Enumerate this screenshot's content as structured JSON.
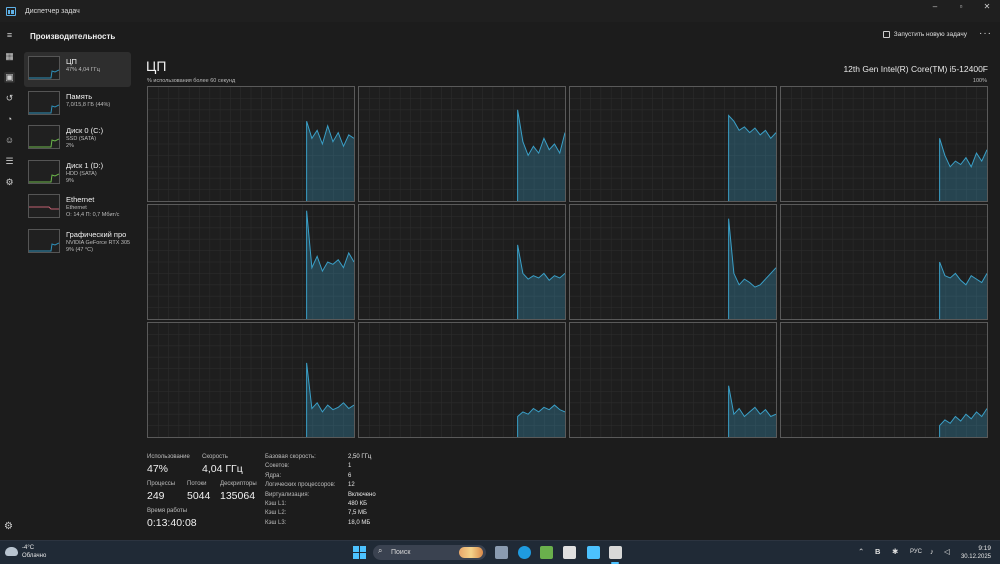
{
  "window": {
    "title": "Диспетчер задач",
    "controls": [
      "–",
      "▫",
      "✕"
    ]
  },
  "header": {
    "page_title": "Производительность",
    "run_task_label": "Запустить новую задачу",
    "more": "···"
  },
  "sidebar": {
    "items": [
      {
        "name": "ЦП",
        "sub1": "47% 4,04 ГГц",
        "sub2": "",
        "sub3": "",
        "selected": true,
        "trace": "#2e8fb8"
      },
      {
        "name": "Память",
        "sub1": "7,0/15,8 ГБ (44%)",
        "sub2": "",
        "sub3": "",
        "selected": false,
        "trace": "#2e8fb8"
      },
      {
        "name": "Диск 0 (C:)",
        "sub1": "SSD (SATA)",
        "sub2": "2%",
        "sub3": "",
        "selected": false,
        "trace": "#6bb64a"
      },
      {
        "name": "Диск 1 (D:)",
        "sub1": "HDD (SATA)",
        "sub2": "9%",
        "sub3": "",
        "selected": false,
        "trace": "#6bb64a"
      },
      {
        "name": "Ethernet",
        "sub1": "Ethernet",
        "sub2": "О: 14,4 П: 0,7 Мбит/с",
        "sub3": "",
        "selected": false,
        "trace": "#c06070"
      },
      {
        "name": "Графический про",
        "sub1": "NVIDIA GeForce RTX 305",
        "sub2": "9% (47 °C)",
        "sub3": "",
        "selected": false,
        "trace": "#2e8fb8"
      }
    ]
  },
  "cpu": {
    "title": "ЦП",
    "model": "12th Gen Intel(R) Core(TM) i5-12400F",
    "axis_label_left": "% использования более 60 секунд",
    "axis_label_right": "100%",
    "graph_color": "#3aa0c8",
    "core_series": [
      [
        0.7,
        0.55,
        0.62,
        0.5,
        0.66,
        0.52,
        0.6,
        0.48,
        0.58,
        0.55
      ],
      [
        0.8,
        0.52,
        0.4,
        0.48,
        0.42,
        0.55,
        0.45,
        0.5,
        0.42,
        0.6
      ],
      [
        0.75,
        0.7,
        0.62,
        0.65,
        0.6,
        0.64,
        0.58,
        0.62,
        0.55,
        0.6
      ],
      [
        0.55,
        0.4,
        0.3,
        0.35,
        0.32,
        0.38,
        0.3,
        0.42,
        0.35,
        0.45
      ],
      [
        0.95,
        0.45,
        0.55,
        0.42,
        0.5,
        0.48,
        0.52,
        0.45,
        0.58,
        0.5
      ],
      [
        0.65,
        0.4,
        0.35,
        0.38,
        0.36,
        0.4,
        0.34,
        0.38,
        0.36,
        0.4
      ],
      [
        0.88,
        0.4,
        0.3,
        0.35,
        0.32,
        0.28,
        0.3,
        0.35,
        0.4,
        0.45
      ],
      [
        0.5,
        0.38,
        0.36,
        0.4,
        0.34,
        0.3,
        0.38,
        0.35,
        0.32,
        0.4
      ],
      [
        0.65,
        0.25,
        0.3,
        0.22,
        0.28,
        0.24,
        0.26,
        0.3,
        0.25,
        0.28
      ],
      [
        0.18,
        0.22,
        0.2,
        0.25,
        0.22,
        0.26,
        0.24,
        0.28,
        0.24,
        0.22
      ],
      [
        0.45,
        0.2,
        0.25,
        0.18,
        0.22,
        0.26,
        0.2,
        0.24,
        0.18,
        0.2
      ],
      [
        0.1,
        0.15,
        0.12,
        0.18,
        0.14,
        0.2,
        0.16,
        0.22,
        0.18,
        0.25
      ]
    ],
    "stats": {
      "usage_label": "Использование",
      "usage_value": "47%",
      "speed_label": "Скорость",
      "speed_value": "4,04 ГГц",
      "processes_label": "Процессы",
      "processes_value": "249",
      "threads_label": "Потоки",
      "threads_value": "5044",
      "handles_label": "Дескрипторы",
      "handles_value": "135064",
      "uptime_label": "Время работы",
      "uptime_value": "0:13:40:08"
    },
    "specs": [
      {
        "k": "Базовая скорость:",
        "v": "2,50 ГГц"
      },
      {
        "k": "Сокетов:",
        "v": "1"
      },
      {
        "k": "Ядра:",
        "v": "6"
      },
      {
        "k": "Логических процессоров:",
        "v": "12"
      },
      {
        "k": "Виртуализация:",
        "v": "Включено"
      },
      {
        "k": "Кэш L1:",
        "v": "480 КБ"
      },
      {
        "k": "Кэш L2:",
        "v": "7,5 МБ"
      },
      {
        "k": "Кэш L3:",
        "v": "18,0 МБ"
      }
    ]
  },
  "taskbar": {
    "weather_temp": "-4°C",
    "weather_desc": "Облачно",
    "search_label": "Поиск",
    "apps": [
      "task-view",
      "edge",
      "store",
      "notepad",
      "task-manager",
      "network-tool"
    ],
    "app_colors": [
      "#8a9bb0",
      "#1f9be0",
      "#6ab04c",
      "#e0e0e0",
      "#4cc2ff",
      "#d8d8d8"
    ],
    "tray_lang": "РУС",
    "time": "9:19",
    "date": "30.12.2025"
  }
}
